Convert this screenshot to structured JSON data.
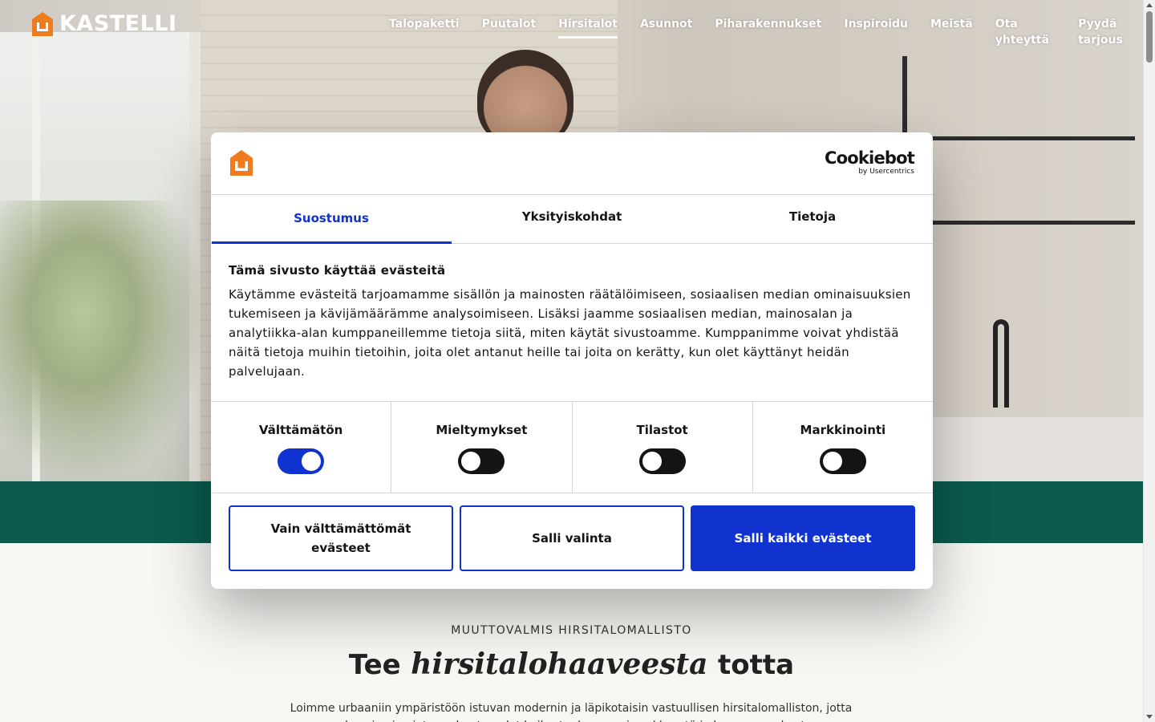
{
  "site": {
    "logo_text": "KASTELLI",
    "nav": [
      {
        "label": "Talopaketti",
        "active": false
      },
      {
        "label": "Puutalot",
        "active": false
      },
      {
        "label": "Hirsitalot",
        "active": true
      },
      {
        "label": "Asunnot",
        "active": false
      },
      {
        "label": "Piharakennukset",
        "active": false
      },
      {
        "label": "Inspiroidu",
        "active": false
      },
      {
        "label": "Meistä",
        "active": false
      },
      {
        "label": "Ota yhteyttä",
        "active": false
      },
      {
        "label": "Pyydä tarjous",
        "active": false
      }
    ],
    "brand_color": "#f07a1e",
    "band_color": "#0b5a4d"
  },
  "section": {
    "eyebrow": "MUUTTOVALMIS HIRSITALOMALLISTO",
    "headline_pre": "Tee",
    "headline_em": "hirsitalohaaveesta",
    "headline_post": "totta",
    "intro": "Loimme urbaaniin ympäristöön istuvan modernin ja läpikotaisin vastuullisen hirsitalomalliston, jotta perheesi voi nojata perheet puolet kaikesta, kaupungin sykkeestä ja luonnon rauhasta."
  },
  "cookie_dialog": {
    "provider_main": "Cookiebot",
    "provider_sub": "by Usercentrics",
    "tabs": [
      {
        "label": "Suostumus",
        "active": true
      },
      {
        "label": "Yksityiskohdat",
        "active": false
      },
      {
        "label": "Tietoja",
        "active": false
      }
    ],
    "title": "Tämä sivusto käyttää evästeitä",
    "body": "Käytämme evästeitä tarjoamamme sisällön ja mainosten räätälöimiseen, sosiaalisen median ominaisuuksien tukemiseen ja kävijämäärämme analysoimiseen. Lisäksi jaamme sosiaalisen median, mainosalan ja analytiikka-alan kumppaneillemme tietoja siitä, miten käytät sivustoamme. Kumppanimme voivat yhdistää näitä tietoja muihin tietoihin, joita olet antanut heille tai joita on kerätty, kun olet käyttänyt heidän palvelujaan.",
    "categories": [
      {
        "label": "Välttämätön",
        "enabled": true
      },
      {
        "label": "Mieltymykset",
        "enabled": false
      },
      {
        "label": "Tilastot",
        "enabled": false
      },
      {
        "label": "Markkinointi",
        "enabled": false
      }
    ],
    "buttons": {
      "necessary_only": "Vain välttämättömät evästeet",
      "allow_selection": "Salli valinta",
      "allow_all": "Salli kaikki evästeet"
    },
    "accent_color": "#1032cf"
  }
}
